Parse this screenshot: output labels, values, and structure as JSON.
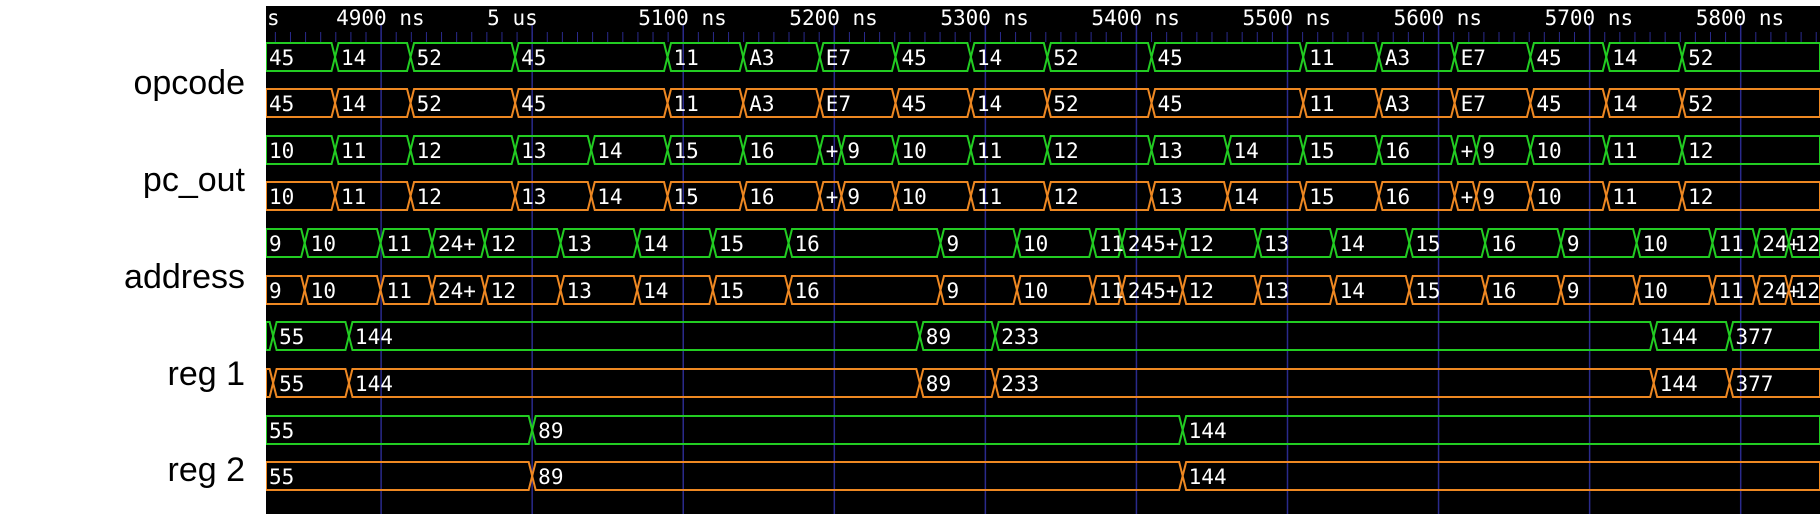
{
  "time_axis": {
    "ticks": [
      {
        "t": 4830,
        "label": "s"
      },
      {
        "t": 4900,
        "label": "4900 ns"
      },
      {
        "t": 5000,
        "label": "5 us"
      },
      {
        "t": 5100,
        "label": "5100 ns"
      },
      {
        "t": 5200,
        "label": "5200 ns"
      },
      {
        "t": 5300,
        "label": "5300 ns"
      },
      {
        "t": 5400,
        "label": "5400 ns"
      },
      {
        "t": 5500,
        "label": "5500 ns"
      },
      {
        "t": 5600,
        "label": "5600 ns"
      },
      {
        "t": 5700,
        "label": "5700 ns"
      },
      {
        "t": 5800,
        "label": "5800 ns"
      }
    ],
    "t_start": 4823.8,
    "t_end": 5852.5
  },
  "signals": [
    {
      "name": "opcode",
      "traces": [
        {
          "color": "#22cc22",
          "segments": [
            {
              "t0": 4823.8,
              "t1": 4869.5,
              "label": "45"
            },
            {
              "t0": 4869.5,
              "t1": 4919.5,
              "label": "14"
            },
            {
              "t0": 4919.5,
              "t1": 4988.7,
              "label": "52"
            },
            {
              "t0": 4988.7,
              "t1": 5089.6,
              "label": "45"
            },
            {
              "t0": 5089.6,
              "t1": 5139.7,
              "label": "11"
            },
            {
              "t0": 5139.7,
              "t1": 5190.4,
              "label": "A3"
            },
            {
              "t0": 5190.4,
              "t1": 5240.5,
              "label": "E7"
            },
            {
              "t0": 5240.5,
              "t1": 5290.4,
              "label": "45"
            },
            {
              "t0": 5290.4,
              "t1": 5341.0,
              "label": "14"
            },
            {
              "t0": 5341.0,
              "t1": 5410.0,
              "label": "52"
            },
            {
              "t0": 5410.0,
              "t1": 5510.4,
              "label": "45"
            },
            {
              "t0": 5510.4,
              "t1": 5560.5,
              "label": "11"
            },
            {
              "t0": 5560.5,
              "t1": 5610.6,
              "label": "A3"
            },
            {
              "t0": 5610.6,
              "t1": 5660.8,
              "label": "E7"
            },
            {
              "t0": 5660.8,
              "t1": 5711.0,
              "label": "45"
            },
            {
              "t0": 5711.0,
              "t1": 5761.2,
              "label": "14"
            },
            {
              "t0": 5761.2,
              "t1": 5852.5,
              "label": "52"
            }
          ]
        },
        {
          "color": "#ee8822",
          "segments": [
            {
              "t0": 4823.8,
              "t1": 4869.5,
              "label": "45"
            },
            {
              "t0": 4869.5,
              "t1": 4919.5,
              "label": "14"
            },
            {
              "t0": 4919.5,
              "t1": 4988.7,
              "label": "52"
            },
            {
              "t0": 4988.7,
              "t1": 5089.6,
              "label": "45"
            },
            {
              "t0": 5089.6,
              "t1": 5139.7,
              "label": "11"
            },
            {
              "t0": 5139.7,
              "t1": 5190.4,
              "label": "A3"
            },
            {
              "t0": 5190.4,
              "t1": 5240.5,
              "label": "E7"
            },
            {
              "t0": 5240.5,
              "t1": 5290.4,
              "label": "45"
            },
            {
              "t0": 5290.4,
              "t1": 5341.0,
              "label": "14"
            },
            {
              "t0": 5341.0,
              "t1": 5410.0,
              "label": "52"
            },
            {
              "t0": 5410.0,
              "t1": 5510.4,
              "label": "45"
            },
            {
              "t0": 5510.4,
              "t1": 5560.5,
              "label": "11"
            },
            {
              "t0": 5560.5,
              "t1": 5610.6,
              "label": "A3"
            },
            {
              "t0": 5610.6,
              "t1": 5660.8,
              "label": "E7"
            },
            {
              "t0": 5660.8,
              "t1": 5711.0,
              "label": "45"
            },
            {
              "t0": 5711.0,
              "t1": 5761.2,
              "label": "14"
            },
            {
              "t0": 5761.2,
              "t1": 5852.5,
              "label": "52"
            }
          ]
        }
      ]
    },
    {
      "name": "pc_out",
      "traces": [
        {
          "color": "#22cc22",
          "segments": [
            {
              "t0": 4823.8,
              "t1": 4869.5,
              "label": "10"
            },
            {
              "t0": 4869.5,
              "t1": 4919.5,
              "label": "11"
            },
            {
              "t0": 4919.5,
              "t1": 4988.7,
              "label": "12"
            },
            {
              "t0": 4988.7,
              "t1": 5039.1,
              "label": "13"
            },
            {
              "t0": 5039.1,
              "t1": 5089.6,
              "label": "14"
            },
            {
              "t0": 5089.6,
              "t1": 5139.7,
              "label": "15"
            },
            {
              "t0": 5139.7,
              "t1": 5190.4,
              "label": "16"
            },
            {
              "t0": 5190.4,
              "t1": 5204.7,
              "label": "+"
            },
            {
              "t0": 5204.7,
              "t1": 5240.5,
              "label": "9"
            },
            {
              "t0": 5240.5,
              "t1": 5290.4,
              "label": "10"
            },
            {
              "t0": 5290.4,
              "t1": 5341.0,
              "label": "11"
            },
            {
              "t0": 5341.0,
              "t1": 5410.0,
              "label": "12"
            },
            {
              "t0": 5410.0,
              "t1": 5460.3,
              "label": "13"
            },
            {
              "t0": 5460.3,
              "t1": 5510.4,
              "label": "14"
            },
            {
              "t0": 5510.4,
              "t1": 5560.5,
              "label": "15"
            },
            {
              "t0": 5560.5,
              "t1": 5610.6,
              "label": "16"
            },
            {
              "t0": 5610.6,
              "t1": 5625.0,
              "label": "+"
            },
            {
              "t0": 5625.0,
              "t1": 5660.8,
              "label": "9"
            },
            {
              "t0": 5660.8,
              "t1": 5711.0,
              "label": "10"
            },
            {
              "t0": 5711.0,
              "t1": 5761.2,
              "label": "11"
            },
            {
              "t0": 5761.2,
              "t1": 5852.5,
              "label": "12"
            }
          ]
        },
        {
          "color": "#ee8822",
          "segments": [
            {
              "t0": 4823.8,
              "t1": 4869.5,
              "label": "10"
            },
            {
              "t0": 4869.5,
              "t1": 4919.5,
              "label": "11"
            },
            {
              "t0": 4919.5,
              "t1": 4988.7,
              "label": "12"
            },
            {
              "t0": 4988.7,
              "t1": 5039.1,
              "label": "13"
            },
            {
              "t0": 5039.1,
              "t1": 5089.6,
              "label": "14"
            },
            {
              "t0": 5089.6,
              "t1": 5139.7,
              "label": "15"
            },
            {
              "t0": 5139.7,
              "t1": 5190.4,
              "label": "16"
            },
            {
              "t0": 5190.4,
              "t1": 5204.7,
              "label": "+"
            },
            {
              "t0": 5204.7,
              "t1": 5240.5,
              "label": "9"
            },
            {
              "t0": 5240.5,
              "t1": 5290.4,
              "label": "10"
            },
            {
              "t0": 5290.4,
              "t1": 5341.0,
              "label": "11"
            },
            {
              "t0": 5341.0,
              "t1": 5410.0,
              "label": "12"
            },
            {
              "t0": 5410.0,
              "t1": 5460.3,
              "label": "13"
            },
            {
              "t0": 5460.3,
              "t1": 5510.4,
              "label": "14"
            },
            {
              "t0": 5510.4,
              "t1": 5560.5,
              "label": "15"
            },
            {
              "t0": 5560.5,
              "t1": 5610.6,
              "label": "16"
            },
            {
              "t0": 5610.6,
              "t1": 5625.0,
              "label": "+"
            },
            {
              "t0": 5625.0,
              "t1": 5660.8,
              "label": "9"
            },
            {
              "t0": 5660.8,
              "t1": 5711.0,
              "label": "10"
            },
            {
              "t0": 5711.0,
              "t1": 5761.2,
              "label": "11"
            },
            {
              "t0": 5761.2,
              "t1": 5852.5,
              "label": "12"
            }
          ]
        }
      ]
    },
    {
      "name": "address",
      "traces": [
        {
          "color": "#22cc22",
          "segments": [
            {
              "t0": 4823.8,
              "t1": 4849.4,
              "label": "9"
            },
            {
              "t0": 4849.4,
              "t1": 4899.6,
              "label": "10"
            },
            {
              "t0": 4899.6,
              "t1": 4933.7,
              "label": "11"
            },
            {
              "t0": 4933.7,
              "t1": 4968.6,
              "label": "24+"
            },
            {
              "t0": 4968.6,
              "t1": 5018.8,
              "label": "12"
            },
            {
              "t0": 5018.8,
              "t1": 5069.5,
              "label": "13"
            },
            {
              "t0": 5069.5,
              "t1": 5119.6,
              "label": "14"
            },
            {
              "t0": 5119.6,
              "t1": 5169.7,
              "label": "15"
            },
            {
              "t0": 5169.7,
              "t1": 5270.3,
              "label": "16"
            },
            {
              "t0": 5270.3,
              "t1": 5320.9,
              "label": "9"
            },
            {
              "t0": 5320.9,
              "t1": 5371.1,
              "label": "10"
            },
            {
              "t0": 5371.1,
              "t1": 5390.4,
              "label": "11"
            },
            {
              "t0": 5390.4,
              "t1": 5430.6,
              "label": "245+"
            },
            {
              "t0": 5430.6,
              "t1": 5480.4,
              "label": "12"
            },
            {
              "t0": 5480.4,
              "t1": 5530.5,
              "label": "13"
            },
            {
              "t0": 5530.5,
              "t1": 5580.6,
              "label": "14"
            },
            {
              "t0": 5580.6,
              "t1": 5630.8,
              "label": "15"
            },
            {
              "t0": 5630.8,
              "t1": 5681.0,
              "label": "16"
            },
            {
              "t0": 5681.0,
              "t1": 5731.1,
              "label": "9"
            },
            {
              "t0": 5731.1,
              "t1": 5781.3,
              "label": "10"
            },
            {
              "t0": 5781.3,
              "t1": 5810.3,
              "label": "11"
            },
            {
              "t0": 5810.3,
              "t1": 5831.8,
              "label": "24+"
            },
            {
              "t0": 5831.8,
              "t1": 5852.5,
              "label": "12"
            }
          ]
        },
        {
          "color": "#ee8822",
          "segments": [
            {
              "t0": 4823.8,
              "t1": 4849.4,
              "label": "9"
            },
            {
              "t0": 4849.4,
              "t1": 4899.6,
              "label": "10"
            },
            {
              "t0": 4899.6,
              "t1": 4933.7,
              "label": "11"
            },
            {
              "t0": 4933.7,
              "t1": 4968.6,
              "label": "24+"
            },
            {
              "t0": 4968.6,
              "t1": 5018.8,
              "label": "12"
            },
            {
              "t0": 5018.8,
              "t1": 5069.5,
              "label": "13"
            },
            {
              "t0": 5069.5,
              "t1": 5119.6,
              "label": "14"
            },
            {
              "t0": 5119.6,
              "t1": 5169.7,
              "label": "15"
            },
            {
              "t0": 5169.7,
              "t1": 5270.3,
              "label": "16"
            },
            {
              "t0": 5270.3,
              "t1": 5320.9,
              "label": "9"
            },
            {
              "t0": 5320.9,
              "t1": 5371.1,
              "label": "10"
            },
            {
              "t0": 5371.1,
              "t1": 5390.4,
              "label": "11"
            },
            {
              "t0": 5390.4,
              "t1": 5430.6,
              "label": "245+"
            },
            {
              "t0": 5430.6,
              "t1": 5480.4,
              "label": "12"
            },
            {
              "t0": 5480.4,
              "t1": 5530.5,
              "label": "13"
            },
            {
              "t0": 5530.5,
              "t1": 5580.6,
              "label": "14"
            },
            {
              "t0": 5580.6,
              "t1": 5630.8,
              "label": "15"
            },
            {
              "t0": 5630.8,
              "t1": 5681.0,
              "label": "16"
            },
            {
              "t0": 5681.0,
              "t1": 5731.1,
              "label": "9"
            },
            {
              "t0": 5731.1,
              "t1": 5781.3,
              "label": "10"
            },
            {
              "t0": 5781.3,
              "t1": 5810.3,
              "label": "11"
            },
            {
              "t0": 5810.3,
              "t1": 5831.8,
              "label": "24+"
            },
            {
              "t0": 5831.8,
              "t1": 5852.5,
              "label": "12"
            }
          ]
        }
      ]
    },
    {
      "name": "reg 1",
      "traces": [
        {
          "color": "#22cc22",
          "segments": [
            {
              "t0": 4823.8,
              "t1": 4828.5,
              "label": ""
            },
            {
              "t0": 4828.5,
              "t1": 4878.7,
              "label": "55"
            },
            {
              "t0": 4878.7,
              "t1": 5256.6,
              "label": "144"
            },
            {
              "t0": 5256.6,
              "t1": 5306.5,
              "label": "89"
            },
            {
              "t0": 5306.5,
              "t1": 5742.4,
              "label": "233"
            },
            {
              "t0": 5742.4,
              "t1": 5792.6,
              "label": "144"
            },
            {
              "t0": 5792.6,
              "t1": 5852.5,
              "label": "377"
            }
          ]
        },
        {
          "color": "#ee8822",
          "segments": [
            {
              "t0": 4823.8,
              "t1": 4828.5,
              "label": ""
            },
            {
              "t0": 4828.5,
              "t1": 4878.7,
              "label": "55"
            },
            {
              "t0": 4878.7,
              "t1": 5256.6,
              "label": "144"
            },
            {
              "t0": 5256.6,
              "t1": 5306.5,
              "label": "89"
            },
            {
              "t0": 5306.5,
              "t1": 5742.4,
              "label": "233"
            },
            {
              "t0": 5742.4,
              "t1": 5792.6,
              "label": "144"
            },
            {
              "t0": 5792.6,
              "t1": 5852.5,
              "label": "377"
            }
          ]
        }
      ]
    },
    {
      "name": "reg 2",
      "traces": [
        {
          "color": "#22cc22",
          "segments": [
            {
              "t0": 4823.8,
              "t1": 5000.0,
              "label": "55"
            },
            {
              "t0": 5000.0,
              "t1": 5430.6,
              "label": "89"
            },
            {
              "t0": 5430.6,
              "t1": 5852.5,
              "label": "144"
            }
          ]
        },
        {
          "color": "#ee8822",
          "segments": [
            {
              "t0": 4823.8,
              "t1": 5000.0,
              "label": "55"
            },
            {
              "t0": 5000.0,
              "t1": 5430.6,
              "label": "89"
            },
            {
              "t0": 5430.6,
              "t1": 5852.5,
              "label": "144"
            }
          ]
        }
      ]
    }
  ],
  "colors": {
    "background": "#000000",
    "grid": "#2a2a8c",
    "axis_text": "#ffffff",
    "value_text": "#ffffff"
  }
}
